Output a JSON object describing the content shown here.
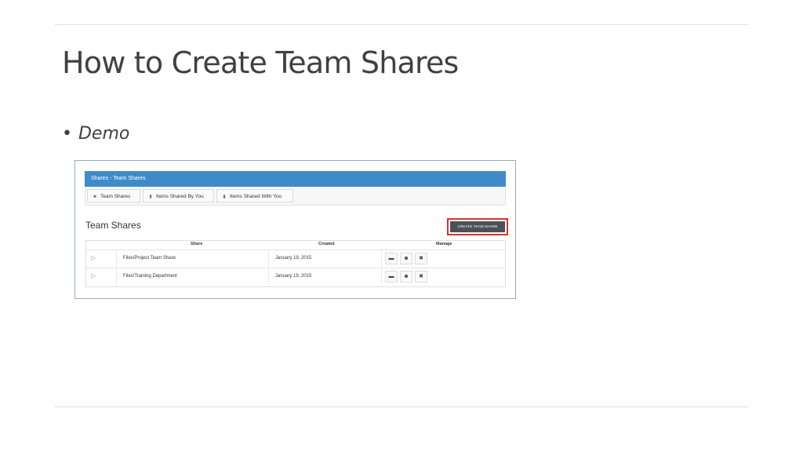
{
  "slide": {
    "title": "How to Create Team Shares",
    "bullet": "Demo"
  },
  "app": {
    "header_title": "Shares - Team Shares",
    "tabs": [
      {
        "label": "Team Shares",
        "icon": "users-icon"
      },
      {
        "label": "Items Shared By You",
        "icon": "document-icon"
      },
      {
        "label": "Items Shared With You",
        "icon": "document-icon"
      }
    ],
    "section_heading": "Team Shares",
    "create_button": "CREATE TEAM SHARE",
    "table": {
      "columns": [
        "Share",
        "Created",
        "Manage"
      ],
      "rows": [
        {
          "share": "Files/Project Team Share",
          "created": "January 19, 2015"
        },
        {
          "share": "Files/Training Department",
          "created": "January 19, 2015"
        }
      ],
      "actions": [
        "folder-icon",
        "users-icon",
        "close-icon"
      ]
    }
  },
  "colors": {
    "header_blue": "#3f8bca",
    "highlight_red": "#d9342b",
    "button_dark": "#4d5156"
  }
}
